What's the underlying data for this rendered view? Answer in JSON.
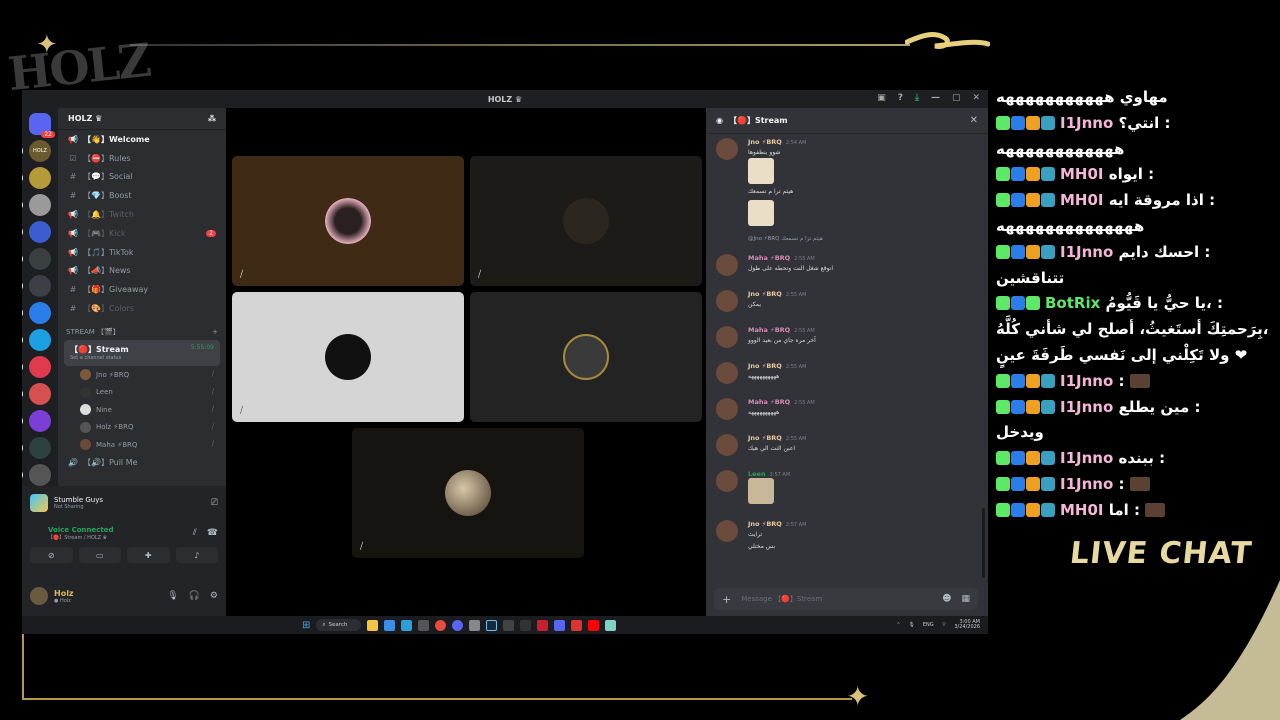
{
  "overlay": {
    "logo": "HOLZ",
    "live_chat_label": "LIVE CHAT"
  },
  "window": {
    "title": "HOLZ ♛"
  },
  "servers": [
    {
      "label": "",
      "badge": "22",
      "color": "#5865f2"
    },
    {
      "label": "HOLZ",
      "badge": "",
      "color": "#6a5a30"
    },
    {
      "label": "",
      "badge": "",
      "color": "#b59a3a"
    },
    {
      "label": "",
      "badge": "",
      "color": "#9a9a9a"
    },
    {
      "label": "",
      "badge": "",
      "color": "#3b5bd1"
    },
    {
      "label": "",
      "badge": "",
      "color": "#3a4040"
    },
    {
      "label": "",
      "badge": "",
      "color": "#3c3f45"
    },
    {
      "label": "",
      "badge": "",
      "color": "#2b7de9"
    },
    {
      "label": "",
      "badge": "",
      "color": "#1ba0e6"
    },
    {
      "label": "",
      "badge": "",
      "color": "#e03a4e"
    },
    {
      "label": "",
      "badge": "",
      "color": "#d65050"
    },
    {
      "label": "",
      "badge": "",
      "color": "#7b3fd8"
    },
    {
      "label": "",
      "badge": "",
      "color": "#2f4040"
    },
    {
      "label": "",
      "badge": "",
      "color": "#555"
    }
  ],
  "guild": {
    "name": "HOLZ ♛",
    "channels": [
      {
        "icon": "📢",
        "label": "【👋】Welcome",
        "state": "active",
        "unread": ""
      },
      {
        "icon": "☑",
        "label": "【⛔】Rules",
        "state": "normal",
        "unread": ""
      },
      {
        "icon": "#",
        "label": "【💬】Social",
        "state": "normal",
        "unread": ""
      },
      {
        "icon": "#",
        "label": "【💎】Boost",
        "state": "normal",
        "unread": ""
      },
      {
        "icon": "📢",
        "label": "【🔔】Twitch",
        "state": "muted",
        "unread": ""
      },
      {
        "icon": "📢",
        "label": "【🎮】Kick",
        "state": "muted",
        "unread": "2"
      },
      {
        "icon": "📢",
        "label": "【🎵】TikTok",
        "state": "normal",
        "unread": ""
      },
      {
        "icon": "📢",
        "label": "【📣】News",
        "state": "normal",
        "unread": ""
      },
      {
        "icon": "#",
        "label": "【🎁】Giveaway",
        "state": "normal",
        "unread": ""
      },
      {
        "icon": "#",
        "label": "【🎨】Colors",
        "state": "muted",
        "unread": ""
      }
    ],
    "category": "STREAM 【🎬】",
    "voice_channel": {
      "name": "【🔴】Stream",
      "status": "Set a channel status",
      "timer": "5:55:09"
    },
    "voice_users": [
      {
        "name": "Jno ⚡BRQ"
      },
      {
        "name": "Leen"
      },
      {
        "name": "Nine"
      },
      {
        "name": "Holz ⚡BRQ"
      },
      {
        "name": "Maha ⚡BRQ"
      }
    ],
    "next_channel": "【🔊】Pull Me"
  },
  "activity": {
    "title": "Stumble Guys",
    "subtitle": "Not Sharing"
  },
  "voice": {
    "status": "Voice Connected",
    "location": "【🔴】Stream / HOLZ ♛"
  },
  "user": {
    "name": "Holz",
    "sub": "● Holz"
  },
  "chat": {
    "title": "【🔴】Stream",
    "messages": [
      {
        "name": "Jno ⚡BRQ",
        "color": "#e8c9a0",
        "time": "2:54 AM",
        "text": "شوو بنظفوها",
        "extra": "هيثم ترا م تسمعك"
      },
      {
        "reply": "@Jno ⚡BRQ هيثم ترا م تسمعك"
      },
      {
        "name": "Maha ⚡BRQ",
        "color": "#d68ab8",
        "time": "2:55 AM",
        "text": "انوقع شغل النت وتحطه على طول"
      },
      {
        "name": "Jno ⚡BRQ",
        "color": "#e8c9a0",
        "time": "2:55 AM",
        "text": "يمكن"
      },
      {
        "name": "Maha ⚡BRQ",
        "color": "#d68ab8",
        "time": "2:55 AM",
        "text": "آخر مره جاي من بعيد الووو"
      },
      {
        "name": "Jno ⚡BRQ",
        "color": "#e8c9a0",
        "time": "2:55 AM",
        "text": "ههههههههههه"
      },
      {
        "name": "Maha ⚡BRQ",
        "color": "#d68ab8",
        "time": "2:55 AM",
        "text": "ههههههههههه"
      },
      {
        "name": "Jno ⚡BRQ",
        "color": "#e8c9a0",
        "time": "2:55 AM",
        "text": "اعبن النت الي هيك"
      },
      {
        "name": "Leen",
        "color": "#23a55a",
        "time": "2:57 AM",
        "text": ""
      },
      {
        "name": "Jno ⚡BRQ",
        "color": "#e8c9a0",
        "time": "2:57 AM",
        "text": "ترايث",
        "extra": "بس مختلي"
      }
    ],
    "input_placeholder": "Message 【🔴】Stream"
  },
  "taskbar": {
    "search": "Search",
    "lang": "ENG",
    "time": "3:00 AM",
    "date": "3/24/2026"
  },
  "live_chat": [
    {
      "name": "",
      "text": "مهاوي هههههههههههه",
      "name_style": ""
    },
    {
      "name": "I1Jnno",
      "text": "انتي؟ :",
      "name_style": "pink"
    },
    {
      "name": "",
      "text": "ههههههههههههه",
      "name_style": ""
    },
    {
      "name": "MH0I",
      "text": "ايواه :",
      "name_style": "pink"
    },
    {
      "name": "MH0I",
      "text": "اذا مروقة ايه :",
      "name_style": "pink"
    },
    {
      "name": "",
      "text": "ههههههههههههههه",
      "name_style": ""
    },
    {
      "name": "I1Jnno",
      "text": "احسك دايم :",
      "name_style": "pink"
    },
    {
      "name": "",
      "text": "تتناقشين",
      "name_style": ""
    },
    {
      "name": "BotRix",
      "text": "يا حيُّ يا قَيُّومُ، :",
      "name_style": "green"
    },
    {
      "name": "",
      "text": "بِرَحمتِكَ أستَغيثُ، أصلح لي شأني كُلَّهُ،",
      "name_style": ""
    },
    {
      "name": "",
      "text": "ولا تَكِلْني إلى نَفسي طَرفَةَ عينٍ ❤",
      "name_style": ""
    },
    {
      "name": "I1Jnno",
      "text": ":",
      "name_style": "pink",
      "emote": true
    },
    {
      "name": "I1Jnno",
      "text": "مين يطلع :",
      "name_style": "pink"
    },
    {
      "name": "",
      "text": "ويدخل",
      "name_style": ""
    },
    {
      "name": "I1Jnno",
      "text": "ببنده :",
      "name_style": "pink"
    },
    {
      "name": "I1Jnno",
      "text": ":",
      "name_style": "pink",
      "emote": true
    },
    {
      "name": "MH0I",
      "text": "اما :",
      "name_style": "pink",
      "emote": true
    }
  ]
}
